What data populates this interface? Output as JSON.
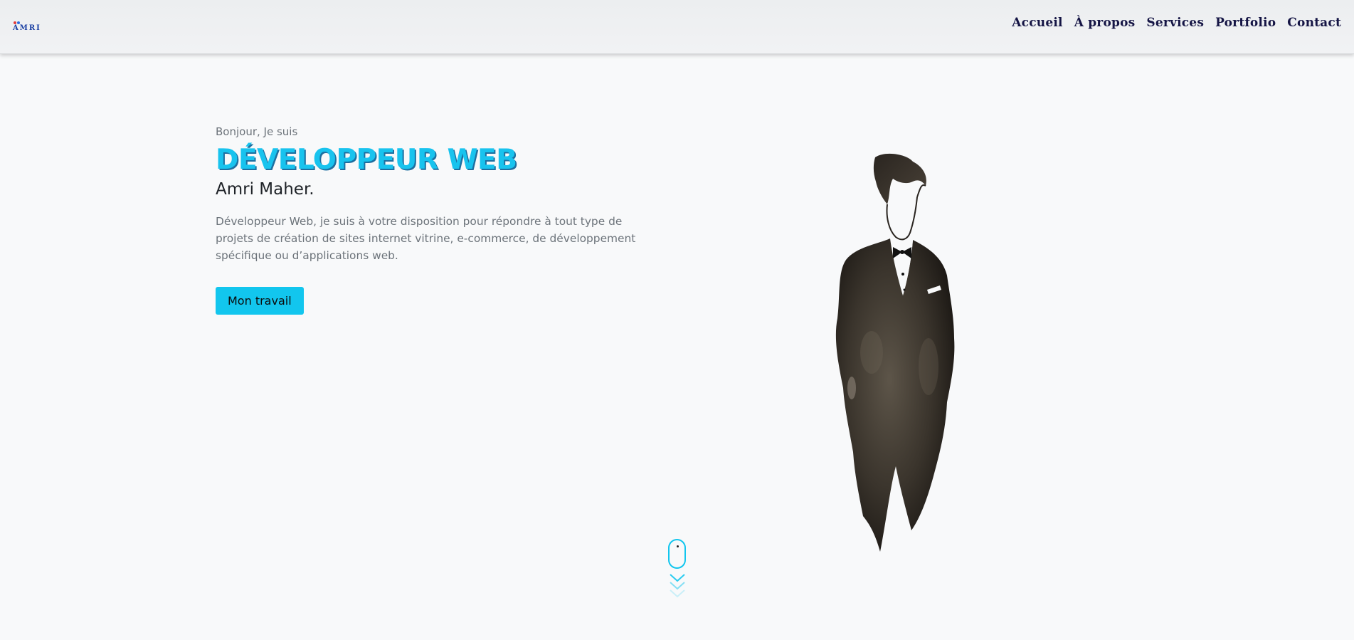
{
  "brand": {
    "logo_text": "AMRI"
  },
  "nav": {
    "items": [
      {
        "label": "Accueil"
      },
      {
        "label": "À propos"
      },
      {
        "label": "Services"
      },
      {
        "label": "Portfolio"
      },
      {
        "label": "Contact"
      }
    ]
  },
  "hero": {
    "greeting": "Bonjour, Je suis",
    "role": "DÉVELOPPEUR WEB",
    "name": "Amri Maher.",
    "description": "Développeur Web, je suis à votre disposition pour répondre à tout type de projets de création de sites internet vitrine, e-commerce, de développement spécifique ou d’applications web.",
    "cta_label": "Mon travail"
  },
  "illustration": {
    "icon": "man-in-tuxedo-watercolor"
  },
  "scroll_indicator": {
    "icon": "mouse-scroll-icon"
  },
  "colors": {
    "accent": "#12c6ee",
    "nav_text": "#151545",
    "background": "#f8f9fa"
  }
}
